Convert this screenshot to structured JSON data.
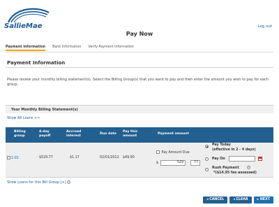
{
  "brand": {
    "logo_text": "SallieMae"
  },
  "header": {
    "title": "Pay Now",
    "logout_label": "Log out"
  },
  "steps": [
    "Payment Information",
    "Bank Information",
    "Verify Payment Information"
  ],
  "section": {
    "title": "Payment Information",
    "intro": "Please review your monthly billing statement(s). Select the Billing Group(s) that you want to pay and then enter the amount you wish to pay for each group."
  },
  "statements": {
    "title": "Your Monthly Billing Statement(s)",
    "show_all": "Show All Loans >>",
    "columns": {
      "billing_group": "Billing group",
      "payoff": "4-day payoff",
      "accrued": "Accrued interest",
      "due_date": "Due date",
      "pay_month": "Pay this amount",
      "payment_amount": "Payment amount"
    },
    "row": {
      "group": "1-01",
      "payoff": "$529.77",
      "accrued": "$1.17",
      "due_date": "02/01/2012",
      "pay_month": "$49.90",
      "pay_amount_due_label": "Pay Amount Due",
      "currency": "$",
      "dollars": "529",
      "cents": "77",
      "decimal": "."
    },
    "options": {
      "pay_today": "Pay Today",
      "pay_today_note": "(effective in 2 - 4 days)",
      "pay_on": "Pay On",
      "rush": "Rush Payment",
      "rush_fee": "*($14.95 fee assessed)"
    },
    "show_loans": "Show Loans for this Bill Group [+]"
  },
  "buttons": {
    "cancel": "CANCEL",
    "clear": "CLEAR",
    "next": "NEXT"
  },
  "colors": {
    "brand_blue": "#1a5a96",
    "table_header": "#235f8f",
    "step_accent": "#f0a000"
  },
  "icons": {
    "logo": "arc-logo-icon",
    "calendar": "calendar-icon",
    "info": "info-icon"
  }
}
